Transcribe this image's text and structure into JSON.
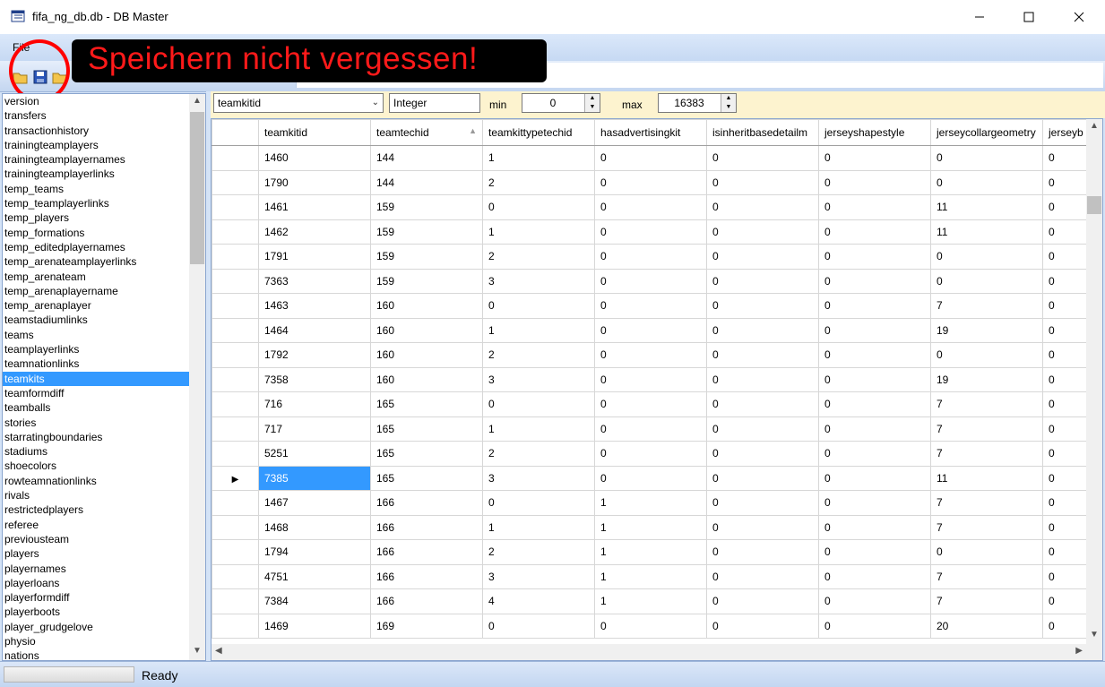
{
  "window": {
    "title": "fifa_ng_db.db - DB Master"
  },
  "menu": {
    "items": [
      "File"
    ]
  },
  "annotation": {
    "text": "Speichern nicht vergessen!"
  },
  "sidebar": {
    "items": [
      "version",
      "transfers",
      "transactionhistory",
      "trainingteamplayers",
      "trainingteamplayernames",
      "trainingteamplayerlinks",
      "temp_teams",
      "temp_teamplayerlinks",
      "temp_players",
      "temp_formations",
      "temp_editedplayernames",
      "temp_arenateamplayerlinks",
      "temp_arenateam",
      "temp_arenaplayername",
      "temp_arenaplayer",
      "teamstadiumlinks",
      "teams",
      "teamplayerlinks",
      "teamnationlinks",
      "teamkits",
      "teamformdiff",
      "teamballs",
      "stories",
      "starratingboundaries",
      "stadiums",
      "shoecolors",
      "rowteamnationlinks",
      "rivals",
      "restrictedplayers",
      "referee",
      "previousteam",
      "players",
      "playernames",
      "playerloans",
      "playerformdiff",
      "playerboots",
      "player_grudgelove",
      "physio",
      "nations"
    ],
    "selected_index": 19
  },
  "filter": {
    "column": "teamkitid",
    "type": "Integer",
    "min_label": "min",
    "min_value": "0",
    "max_label": "max",
    "max_value": "16383"
  },
  "grid": {
    "columns": [
      "teamkitid",
      "teamtechid",
      "teamkittypetechid",
      "hasadvertisingkit",
      "isinheritbasedetailm",
      "jerseyshapestyle",
      "jerseycollargeometry",
      "jerseyb"
    ],
    "current_row": 13,
    "rows": [
      [
        "1460",
        "144",
        "1",
        "0",
        "0",
        "0",
        "0",
        "0"
      ],
      [
        "1790",
        "144",
        "2",
        "0",
        "0",
        "0",
        "0",
        "0"
      ],
      [
        "1461",
        "159",
        "0",
        "0",
        "0",
        "0",
        "11",
        "0"
      ],
      [
        "1462",
        "159",
        "1",
        "0",
        "0",
        "0",
        "11",
        "0"
      ],
      [
        "1791",
        "159",
        "2",
        "0",
        "0",
        "0",
        "0",
        "0"
      ],
      [
        "7363",
        "159",
        "3",
        "0",
        "0",
        "0",
        "0",
        "0"
      ],
      [
        "1463",
        "160",
        "0",
        "0",
        "0",
        "0",
        "7",
        "0"
      ],
      [
        "1464",
        "160",
        "1",
        "0",
        "0",
        "0",
        "19",
        "0"
      ],
      [
        "1792",
        "160",
        "2",
        "0",
        "0",
        "0",
        "0",
        "0"
      ],
      [
        "7358",
        "160",
        "3",
        "0",
        "0",
        "0",
        "19",
        "0"
      ],
      [
        "716",
        "165",
        "0",
        "0",
        "0",
        "0",
        "7",
        "0"
      ],
      [
        "717",
        "165",
        "1",
        "0",
        "0",
        "0",
        "7",
        "0"
      ],
      [
        "5251",
        "165",
        "2",
        "0",
        "0",
        "0",
        "7",
        "0"
      ],
      [
        "7385",
        "165",
        "3",
        "0",
        "0",
        "0",
        "11",
        "0"
      ],
      [
        "1467",
        "166",
        "0",
        "1",
        "0",
        "0",
        "7",
        "0"
      ],
      [
        "1468",
        "166",
        "1",
        "1",
        "0",
        "0",
        "7",
        "0"
      ],
      [
        "1794",
        "166",
        "2",
        "1",
        "0",
        "0",
        "0",
        "0"
      ],
      [
        "4751",
        "166",
        "3",
        "1",
        "0",
        "0",
        "7",
        "0"
      ],
      [
        "7384",
        "166",
        "4",
        "1",
        "0",
        "0",
        "7",
        "0"
      ],
      [
        "1469",
        "169",
        "0",
        "0",
        "0",
        "0",
        "20",
        "0"
      ]
    ]
  },
  "status": {
    "text": "Ready"
  },
  "colors": {
    "selection": "#3399ff",
    "annotation": "#ff1a1a",
    "filterbar": "#fdf3cf"
  }
}
